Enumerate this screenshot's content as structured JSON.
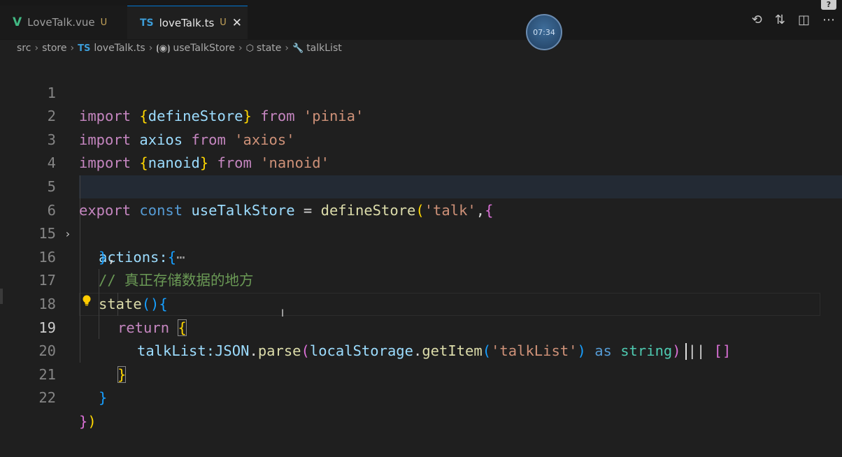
{
  "tabs": [
    {
      "icon": "V",
      "label": "LoveTalk.vue",
      "status": "U",
      "active": false
    },
    {
      "icon": "TS",
      "label": "loveTalk.ts",
      "status": "U",
      "active": true
    }
  ],
  "timer": "07:34",
  "breadcrumb": {
    "items": [
      "src",
      "store",
      "loveTalk.ts",
      "useTalkStore",
      "state",
      "talkList"
    ],
    "ts_icon": "TS"
  },
  "editor": {
    "line_numbers": [
      "1",
      "2",
      "3",
      "4",
      "5",
      "6",
      "15",
      "16",
      "17",
      "18",
      "19",
      "20",
      "21",
      "22"
    ],
    "current_line": "19",
    "lines": {
      "l1": {
        "kw": "import",
        "b1": "{",
        "name": "defineStore",
        "b2": "}",
        "from": "from",
        "str": "'pinia'"
      },
      "l2": {
        "kw": "import",
        "name": "axios",
        "from": "from",
        "str": "'axios'"
      },
      "l3": {
        "kw": "import",
        "b1": "{",
        "name": "nanoid",
        "b2": "}",
        "from": "from",
        "str": "'nanoid'"
      },
      "l5": {
        "kw1": "export",
        "kw2": "const",
        "name": "useTalkStore",
        "eq": "=",
        "fn": "defineStore",
        "p1": "(",
        "str": "'talk'",
        "comma": ",",
        "b1": "{"
      },
      "l6": {
        "name": "actions:",
        "b1": "{",
        "ellipsis": "⋯"
      },
      "l15": {
        "b1": "}",
        "comma": ","
      },
      "l16": {
        "comment": "// 真正存储数据的地方"
      },
      "l17": {
        "fn": "state",
        "parens": "()",
        "b1": "{"
      },
      "l18": {
        "kw": "return",
        "b1": "{"
      },
      "l19": {
        "prop": "talkList:",
        "obj": "JSON",
        "dot": ".",
        "fn1": "parse",
        "p1": "(",
        "obj2": "localStorage",
        "dot2": ".",
        "fn2": "getItem",
        "p2": "(",
        "str": "'talkList'",
        "p2c": ")",
        "as": "as",
        "type": "string",
        "p1c": ")",
        "or": "||",
        "arr": "[]"
      },
      "l20": {
        "b1": "}"
      },
      "l21": {
        "b1": "}"
      },
      "l22": {
        "b1": "}",
        "p1": ")"
      }
    }
  }
}
